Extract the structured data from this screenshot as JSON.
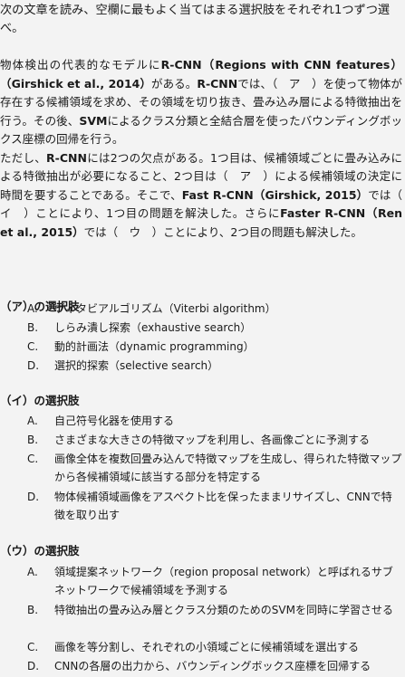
{
  "instruction": "次の文章を読み、空欄に最もよく当てはまる選択肢をそれぞれ1つずつ選べ。",
  "passage": {
    "p1_a": "物体検出の代表的なモデルに",
    "p1_rcnn": "R-CNN（Regions with CNN features）（Girshick et al., 2014）",
    "p1_b": "がある。",
    "p1_rcnn2": "R-CNN",
    "p1_c": "では、（　ア　）を使って物体が存在する候補領域を求め、その領域を切り抜き、畳み込み層による特徴抽出を行う。その後、",
    "p1_svm": "SVM",
    "p1_d": "によるクラス分類と全結合層を使ったバウンディングボックス座標の回帰を行う。",
    "p2_a": "ただし、",
    "p2_rcnn": "R-CNN",
    "p2_b": "には2つの欠点がある。1つ目は、候補領域ごとに畳み込みによる特徴抽出が必要になること、2つ目は（　ア　）による候補領域の決定に時間を要することである。そこで、",
    "p2_fast": "Fast R-CNN（Girshick, 2015）",
    "p2_c": "では（　イ　）ことにより、1つ目の問題を解決した。さらに",
    "p2_faster": "Faster R-CNN（Ren et al., 2015）",
    "p2_d": "では（　ウ　）ことにより、2つ目の問題も解決した。"
  },
  "groups": [
    {
      "title": "（ア）の選択肢",
      "options": [
        {
          "letter": "A.",
          "text": "ヴィタビアルゴリズム（Viterbi algorithm）"
        },
        {
          "letter": "B.",
          "text": "しらみ潰し探索（exhaustive search）"
        },
        {
          "letter": "C.",
          "text": "動的計画法（dynamic programming）"
        },
        {
          "letter": "D.",
          "text": "選択的探索（selective search）"
        }
      ]
    },
    {
      "title": "（イ）の選択肢",
      "options": [
        {
          "letter": "A.",
          "text": "自己符号化器を使用する"
        },
        {
          "letter": "B.",
          "text": "さまざまな大きさの特徴マップを利用し、各画像ごとに予測する"
        },
        {
          "letter": "C.",
          "text": "画像全体を複数回畳み込んで特徴マップを生成し、得られた特徴マップから各候補領域に該当する部分を特定する"
        },
        {
          "letter": "D.",
          "text": "物体候補領域画像をアスペクト比を保ったままリサイズし、CNNで特徴を取り出す"
        }
      ]
    },
    {
      "title": "（ウ）の選択肢",
      "options": [
        {
          "letter": "A.",
          "text": "領域提案ネットワーク（region proposal network）と呼ばれるサブネットワークで候補領域を予測する"
        },
        {
          "letter": "B.",
          "text": "特徴抽出の畳み込み層とクラス分類のためのSVMを同時に学習させる"
        },
        {
          "letter": "C.",
          "text": "画像を等分割し、それぞれの小領域ごとに候補領域を選出する"
        },
        {
          "letter": "D.",
          "text": "CNNの各層の出力から、バウンディングボックス座標を回帰する"
        }
      ]
    }
  ]
}
